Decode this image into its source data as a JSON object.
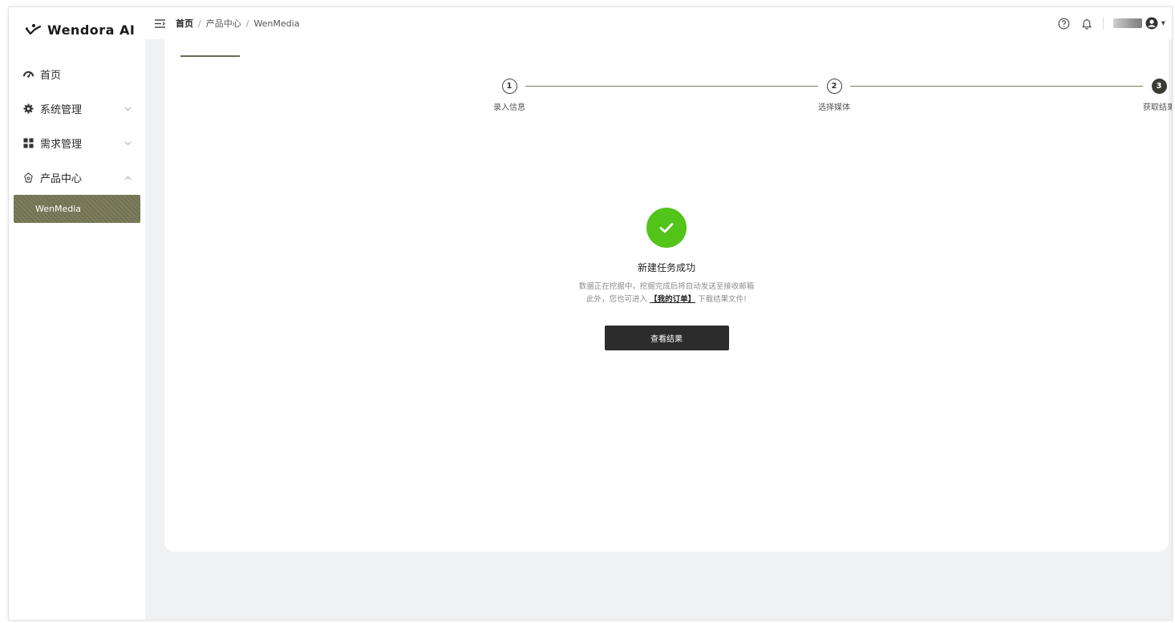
{
  "app": {
    "logo_text": "Wendora AI"
  },
  "sidebar": {
    "items": [
      {
        "label": "首页",
        "icon": "dashboard-icon",
        "expandable": false
      },
      {
        "label": "系统管理",
        "icon": "gear-icon",
        "expandable": true,
        "expanded": false
      },
      {
        "label": "需求管理",
        "icon": "grid-icon",
        "expandable": true,
        "expanded": false
      },
      {
        "label": "产品中心",
        "icon": "product-icon",
        "expandable": true,
        "expanded": true
      }
    ],
    "submenu": {
      "active_label": "WenMedia"
    }
  },
  "header": {
    "breadcrumb": [
      "首页",
      "产品中心",
      "WenMedia"
    ],
    "separator": "/",
    "icons": [
      "help-icon",
      "bell-icon",
      "user-avatar-icon"
    ]
  },
  "steps": [
    {
      "number": "1",
      "label": "录入信息",
      "status": "complete"
    },
    {
      "number": "2",
      "label": "选择媒体",
      "status": "complete"
    },
    {
      "number": "3",
      "label": "获取结果",
      "status": "current"
    }
  ],
  "result": {
    "title": "新建任务成功",
    "desc_line1": "数据正在挖掘中，挖掘完成后将自动发送至接收邮箱",
    "desc_line2_prefix": "此外，您也可进入",
    "desc_link": "【我的订单】",
    "desc_line2_suffix": "下载结果文件!",
    "button_label": "查看结果"
  },
  "colors": {
    "accent": "#767556",
    "success": "#52c41a",
    "button_dark": "#2c2c2c",
    "background": "#f0f1f3"
  }
}
